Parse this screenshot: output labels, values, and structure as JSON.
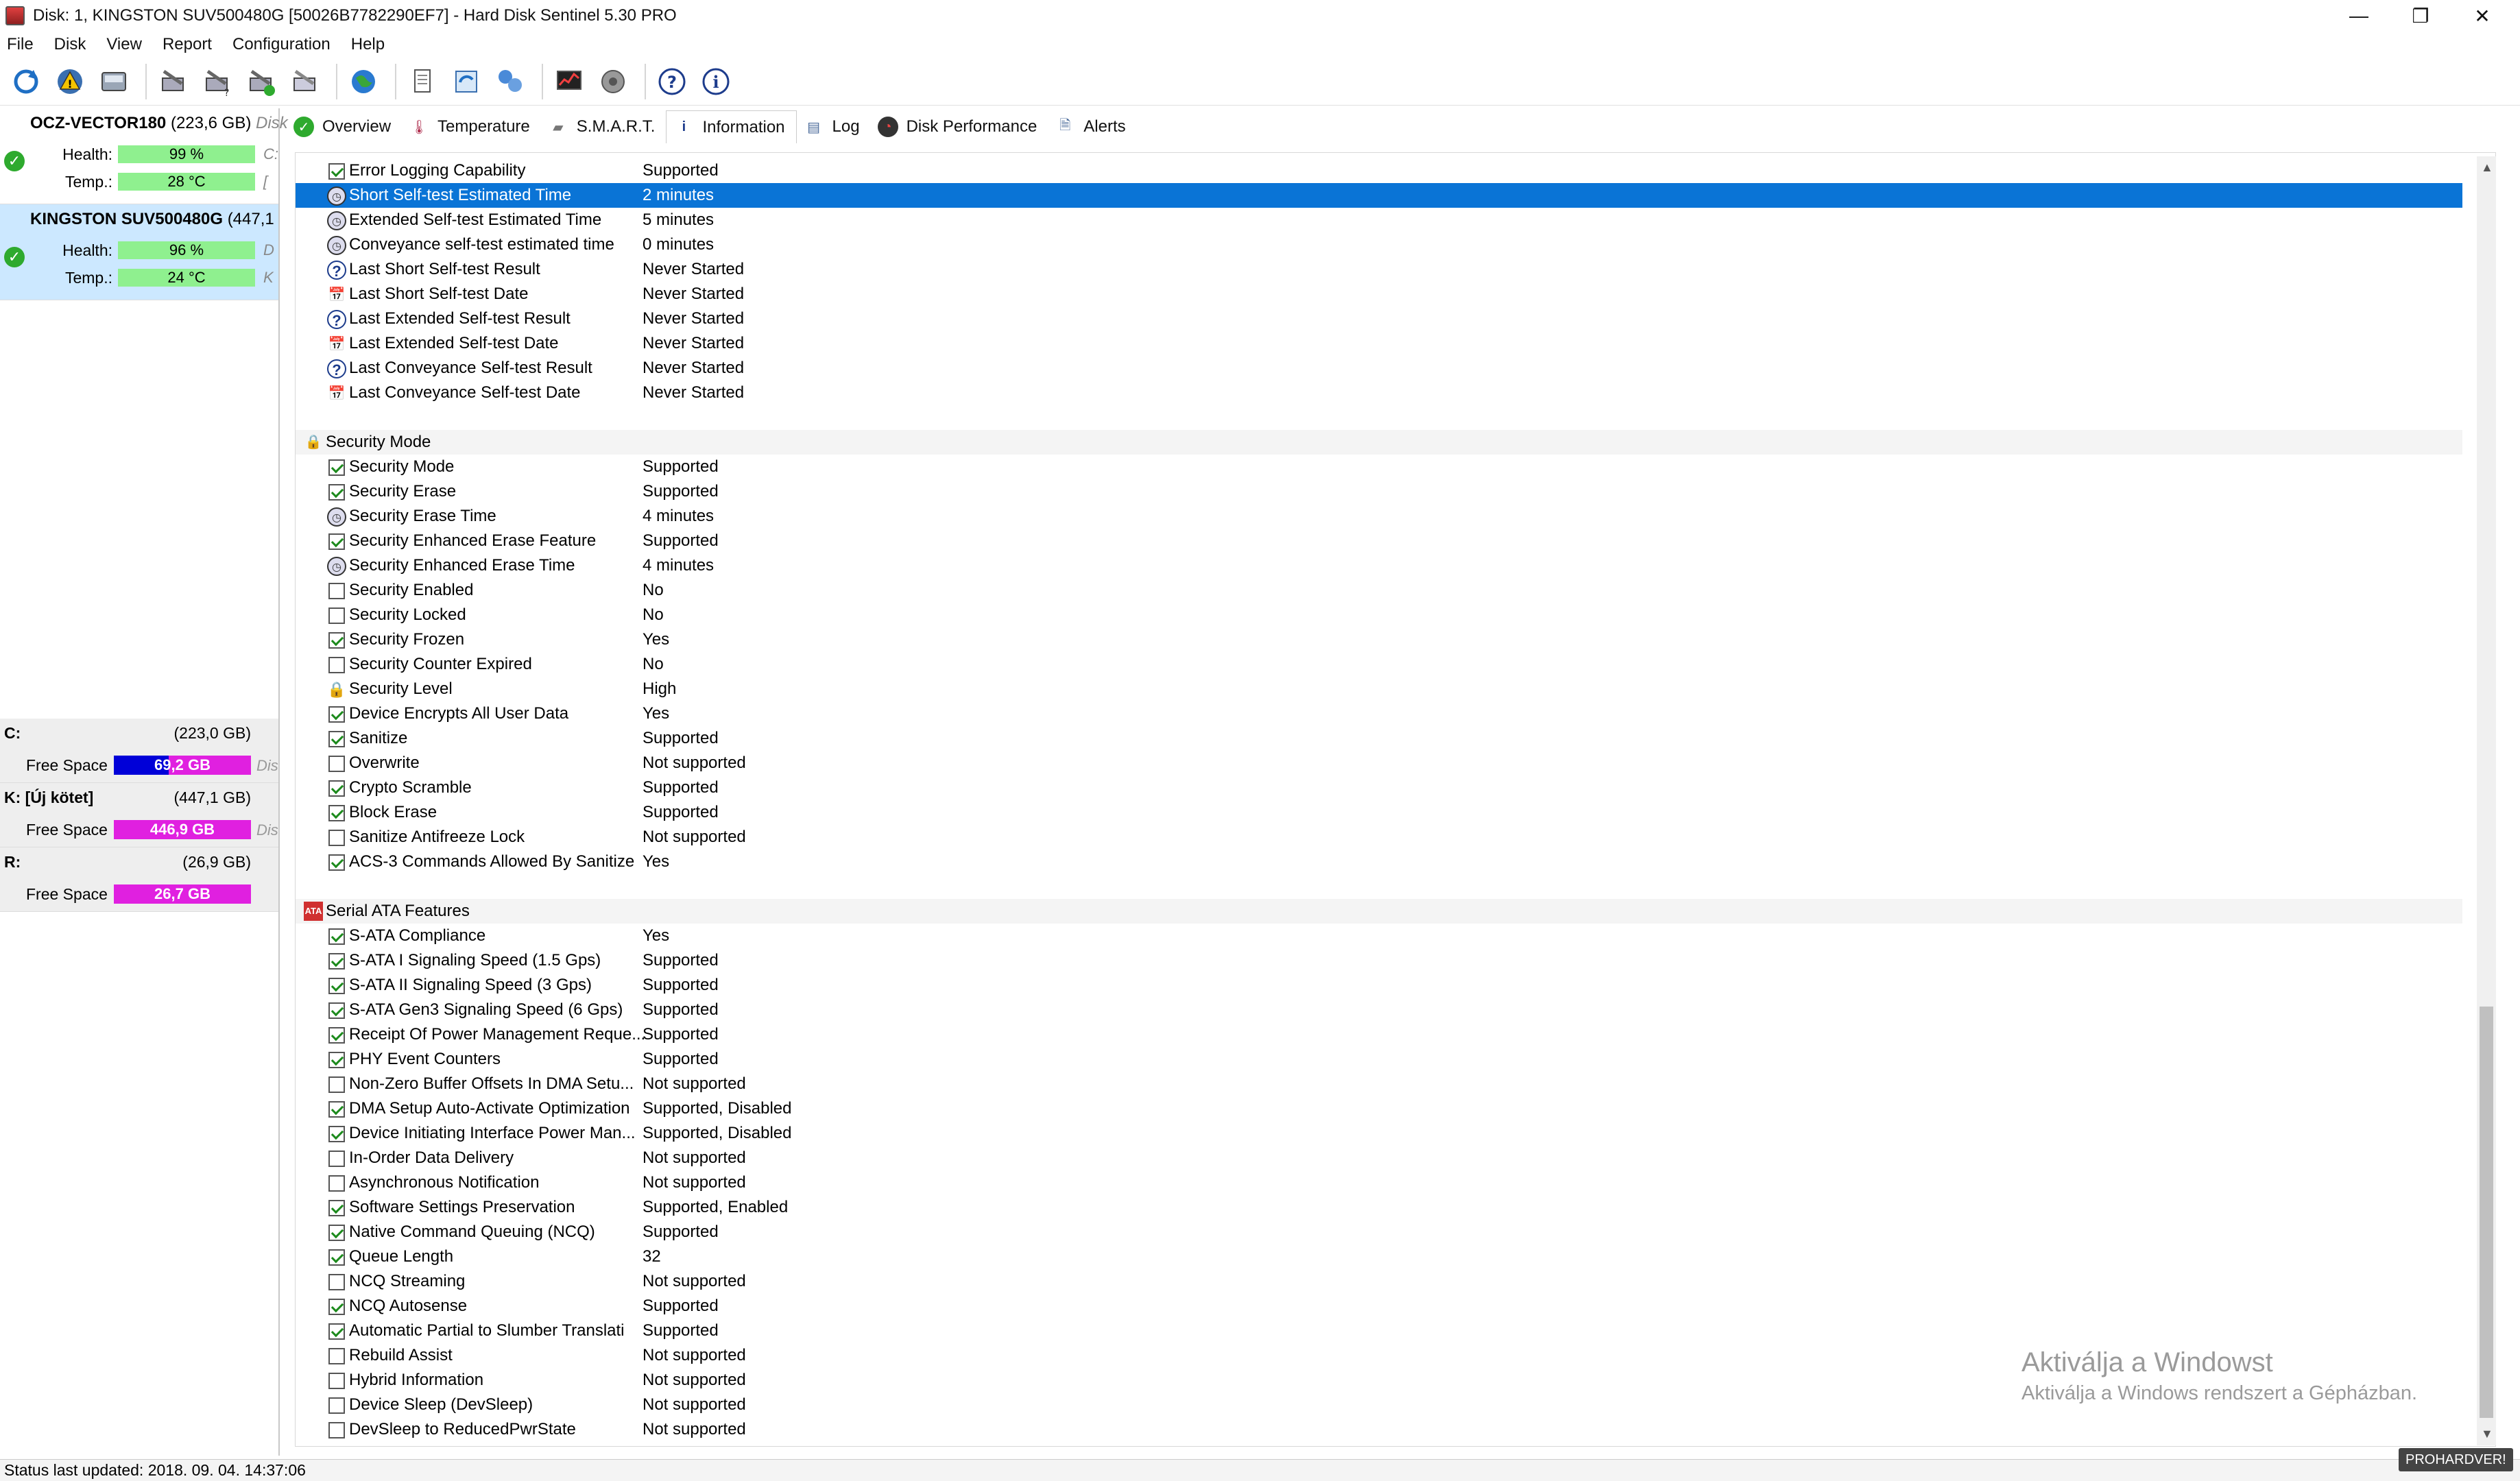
{
  "window": {
    "title": "Disk: 1, KINGSTON SUV500480G [50026B7782290EF7]  -  Hard Disk Sentinel 5.30 PRO",
    "minimize": "—",
    "maximize": "❐",
    "close": "✕"
  },
  "menu": [
    "File",
    "Disk",
    "View",
    "Report",
    "Configuration",
    "Help"
  ],
  "disks": [
    {
      "name": "OCZ-VECTOR180",
      "size": "(223,6 GB)",
      "extra": "Disk",
      "health_label": "Health:",
      "health": "99 %",
      "temp_label": "Temp.:",
      "temp": "28 °C",
      "health_extra": "C:",
      "temp_extra": "["
    },
    {
      "name": "KINGSTON SUV500480G",
      "size": "(447,1",
      "extra": "",
      "health_label": "Health:",
      "health": "96 %",
      "temp_label": "Temp.:",
      "temp": "24 °C",
      "health_extra": "D",
      "temp_extra": "K"
    }
  ],
  "drives": [
    {
      "letter": "C:",
      "size": "(223,0 GB)",
      "free_label": "Free Space",
      "free": "69,2 GB",
      "extra": "Dis"
    },
    {
      "letter": "K: [Új kötet]",
      "size": "(447,1 GB)",
      "free_label": "Free Space",
      "free": "446,9 GB",
      "extra": "Dis"
    },
    {
      "letter": "R:",
      "size": "(26,9 GB)",
      "free_label": "Free Space",
      "free": "26,7 GB",
      "extra": ""
    }
  ],
  "tabs": [
    {
      "label": "Overview",
      "icon": "check-circle-icon"
    },
    {
      "label": "Temperature",
      "icon": "thermometer-icon"
    },
    {
      "label": "S.M.A.R.T.",
      "icon": "disk-icon"
    },
    {
      "label": "Information",
      "icon": "info-icon"
    },
    {
      "label": "Log",
      "icon": "log-icon"
    },
    {
      "label": "Disk Performance",
      "icon": "gauge-icon"
    },
    {
      "label": "Alerts",
      "icon": "alert-doc-icon"
    }
  ],
  "rows": [
    {
      "type": "item",
      "icon": "check",
      "label": "Error Logging Capability",
      "value": "Supported"
    },
    {
      "type": "item",
      "icon": "clock",
      "label": "Short Self-test Estimated Time",
      "value": "2 minutes",
      "selected": true
    },
    {
      "type": "item",
      "icon": "clock",
      "label": "Extended Self-test Estimated Time",
      "value": "5 minutes"
    },
    {
      "type": "item",
      "icon": "clock",
      "label": "Conveyance self-test estimated time",
      "value": "0 minutes"
    },
    {
      "type": "item",
      "icon": "q",
      "label": "Last Short Self-test Result",
      "value": "Never Started"
    },
    {
      "type": "item",
      "icon": "date",
      "label": "Last Short Self-test Date",
      "value": "Never Started"
    },
    {
      "type": "item",
      "icon": "q",
      "label": "Last Extended Self-test Result",
      "value": "Never Started"
    },
    {
      "type": "item",
      "icon": "date",
      "label": "Last Extended Self-test Date",
      "value": "Never Started"
    },
    {
      "type": "item",
      "icon": "q",
      "label": "Last Conveyance Self-test Result",
      "value": "Never Started"
    },
    {
      "type": "item",
      "icon": "date",
      "label": "Last Conveyance Self-test Date",
      "value": "Never Started"
    },
    {
      "type": "spacer"
    },
    {
      "type": "section",
      "icon": "lock",
      "label": "Security Mode"
    },
    {
      "type": "item",
      "icon": "check",
      "label": "Security Mode",
      "value": "Supported"
    },
    {
      "type": "item",
      "icon": "check",
      "label": "Security Erase",
      "value": "Supported"
    },
    {
      "type": "item",
      "icon": "clock",
      "label": "Security Erase Time",
      "value": "4 minutes"
    },
    {
      "type": "item",
      "icon": "check",
      "label": "Security Enhanced Erase Feature",
      "value": "Supported"
    },
    {
      "type": "item",
      "icon": "clock",
      "label": "Security Enhanced Erase Time",
      "value": "4 minutes"
    },
    {
      "type": "item",
      "icon": "uncheck",
      "label": "Security Enabled",
      "value": "No"
    },
    {
      "type": "item",
      "icon": "uncheck",
      "label": "Security Locked",
      "value": "No"
    },
    {
      "type": "item",
      "icon": "check",
      "label": "Security Frozen",
      "value": "Yes"
    },
    {
      "type": "item",
      "icon": "uncheck",
      "label": "Security Counter Expired",
      "value": "No"
    },
    {
      "type": "item",
      "icon": "lock",
      "label": "Security Level",
      "value": "High"
    },
    {
      "type": "item",
      "icon": "check",
      "label": "Device Encrypts All User Data",
      "value": "Yes"
    },
    {
      "type": "item",
      "icon": "check",
      "label": "Sanitize",
      "value": "Supported"
    },
    {
      "type": "item",
      "icon": "uncheck",
      "label": "Overwrite",
      "value": "Not supported"
    },
    {
      "type": "item",
      "icon": "check",
      "label": "Crypto Scramble",
      "value": "Supported"
    },
    {
      "type": "item",
      "icon": "check",
      "label": "Block Erase",
      "value": "Supported"
    },
    {
      "type": "item",
      "icon": "uncheck",
      "label": "Sanitize Antifreeze Lock",
      "value": "Not supported"
    },
    {
      "type": "item",
      "icon": "check",
      "label": "ACS-3 Commands Allowed By Sanitize",
      "value": "Yes"
    },
    {
      "type": "spacer"
    },
    {
      "type": "section",
      "icon": "ata",
      "label": "Serial ATA Features"
    },
    {
      "type": "item",
      "icon": "check",
      "label": "S-ATA Compliance",
      "value": "Yes"
    },
    {
      "type": "item",
      "icon": "check",
      "label": "S-ATA I Signaling Speed (1.5 Gps)",
      "value": "Supported"
    },
    {
      "type": "item",
      "icon": "check",
      "label": "S-ATA II Signaling Speed (3 Gps)",
      "value": "Supported"
    },
    {
      "type": "item",
      "icon": "check",
      "label": "S-ATA Gen3 Signaling Speed (6 Gps)",
      "value": "Supported"
    },
    {
      "type": "item",
      "icon": "check",
      "label": "Receipt Of Power Management Reque...",
      "value": "Supported"
    },
    {
      "type": "item",
      "icon": "check",
      "label": "PHY Event Counters",
      "value": "Supported"
    },
    {
      "type": "item",
      "icon": "uncheck",
      "label": "Non-Zero Buffer Offsets In DMA Setu...",
      "value": "Not supported"
    },
    {
      "type": "item",
      "icon": "check",
      "label": "DMA Setup Auto-Activate Optimization",
      "value": "Supported, Disabled"
    },
    {
      "type": "item",
      "icon": "check",
      "label": "Device Initiating Interface Power Man...",
      "value": "Supported, Disabled"
    },
    {
      "type": "item",
      "icon": "uncheck",
      "label": "In-Order Data Delivery",
      "value": "Not supported"
    },
    {
      "type": "item",
      "icon": "uncheck",
      "label": "Asynchronous Notification",
      "value": "Not supported"
    },
    {
      "type": "item",
      "icon": "check",
      "label": "Software Settings Preservation",
      "value": "Supported, Enabled"
    },
    {
      "type": "item",
      "icon": "check",
      "label": "Native Command Queuing (NCQ)",
      "value": "Supported"
    },
    {
      "type": "item",
      "icon": "check",
      "label": "Queue Length",
      "value": "32"
    },
    {
      "type": "item",
      "icon": "uncheck",
      "label": "NCQ Streaming",
      "value": "Not supported"
    },
    {
      "type": "item",
      "icon": "check",
      "label": "NCQ Autosense",
      "value": "Supported"
    },
    {
      "type": "item",
      "icon": "check",
      "label": "Automatic Partial to Slumber Translati",
      "value": "Supported"
    },
    {
      "type": "item",
      "icon": "uncheck",
      "label": "Rebuild Assist",
      "value": "Not supported"
    },
    {
      "type": "item",
      "icon": "uncheck",
      "label": "Hybrid Information",
      "value": "Not supported"
    },
    {
      "type": "item",
      "icon": "uncheck",
      "label": "Device Sleep (DevSleep)",
      "value": "Not supported"
    },
    {
      "type": "item",
      "icon": "uncheck",
      "label": "DevSleep to ReducedPwrState",
      "value": "Not supported"
    }
  ],
  "watermark": {
    "line1": "Aktiválja a Windowst",
    "line2": "Aktiválja a Windows rendszert a Gépházban."
  },
  "status": "Status last updated: 2018. 09. 04. 14:37:06",
  "badge": "PROHARDVER!",
  "colors": {
    "selection": "#0a74d6",
    "health_bar": "#8ff08f",
    "free_blue": "#0000d8",
    "free_magenta": "#e020e0"
  }
}
